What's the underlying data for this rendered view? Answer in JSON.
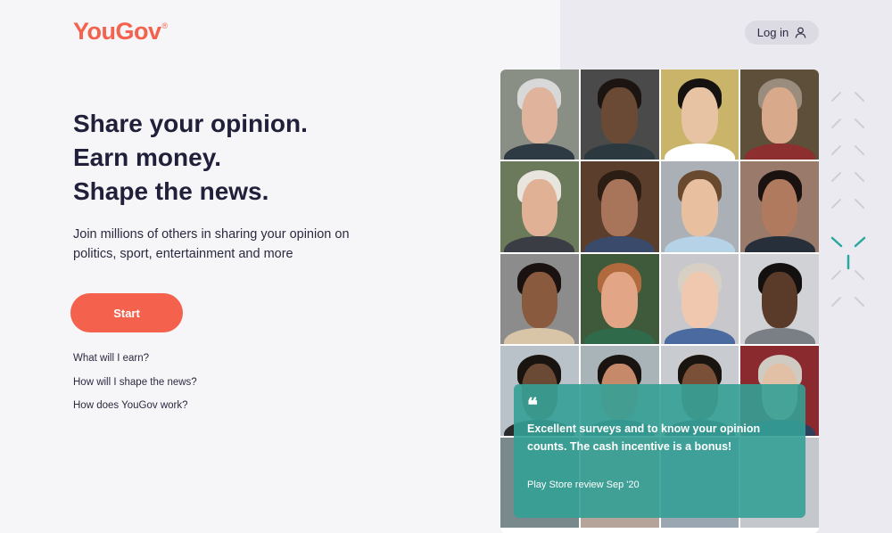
{
  "header": {
    "logo_text": "YouGov",
    "logo_mark": "®",
    "login_label": "Log in",
    "login_icon": "user-icon"
  },
  "hero": {
    "headline": [
      "Share your opinion.",
      "Earn money.",
      "Shape the news."
    ],
    "subtext": "Join millions of others in sharing your opinion on politics, sport, entertainment and more",
    "start_label": "Start"
  },
  "faq": {
    "items": [
      "What will I earn?",
      "How will I shape the news?",
      "How does YouGov work?"
    ]
  },
  "review": {
    "quote_mark": "❝",
    "text": "Excellent surveys and to know your opinion counts. The cash incentive is a bonus!",
    "source": "Play Store review Sep '20"
  },
  "colors": {
    "brand": "#f4614c",
    "review_bg": "#34a096",
    "accent_deco": "#2aa7a0",
    "page_bg": "#f6f5f8",
    "panel_bg": "#ebeaf0"
  }
}
